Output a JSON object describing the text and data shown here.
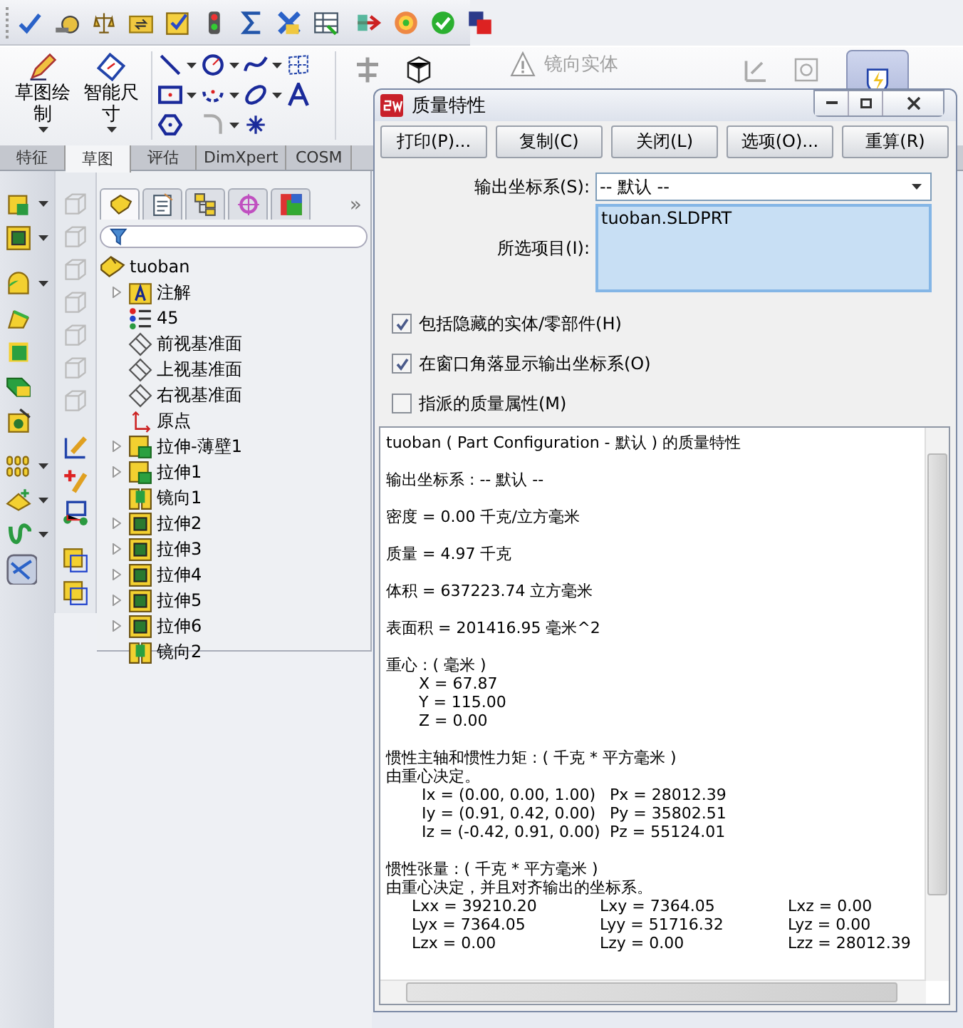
{
  "ribbon": {
    "buttons": [
      {
        "label": "草图绘制"
      },
      {
        "label": "智能尺寸"
      }
    ],
    "mirror_entities": {
      "label": "镜向实体",
      "disabled": true
    }
  },
  "tabs": [
    {
      "label": "特征",
      "selected": false
    },
    {
      "label": "草图",
      "selected": true
    },
    {
      "label": "评估",
      "selected": false
    },
    {
      "label": "DimXpert",
      "selected": false
    },
    {
      "label": "COSM",
      "selected": false
    }
  ],
  "panel_tabs": [
    {
      "selected": true
    },
    {
      "selected": false
    },
    {
      "selected": false
    },
    {
      "selected": false
    },
    {
      "selected": false
    }
  ],
  "panel_more": "»",
  "tree": {
    "label": "tuoban",
    "children": [
      {
        "label": "注解",
        "kind": "annotations",
        "expandable": true
      },
      {
        "label": "45",
        "kind": "sensors",
        "expandable": false
      },
      {
        "label": "前视基准面",
        "kind": "plane",
        "expandable": false
      },
      {
        "label": "上视基准面",
        "kind": "plane",
        "expandable": false
      },
      {
        "label": "右视基准面",
        "kind": "plane",
        "expandable": false
      },
      {
        "label": "原点",
        "kind": "origin",
        "expandable": false
      },
      {
        "label": "拉伸-薄壁1",
        "kind": "thin_extrude",
        "expandable": true
      },
      {
        "label": "拉伸1",
        "kind": "thin_extrude",
        "expandable": true
      },
      {
        "label": "镜向1",
        "kind": "mirror",
        "expandable": false
      },
      {
        "label": "拉伸2",
        "kind": "extrude",
        "expandable": true
      },
      {
        "label": "拉伸3",
        "kind": "extrude",
        "expandable": true
      },
      {
        "label": "拉伸4",
        "kind": "extrude",
        "expandable": true
      },
      {
        "label": "拉伸5",
        "kind": "extrude",
        "expandable": true
      },
      {
        "label": "拉伸6",
        "kind": "extrude",
        "expandable": true
      },
      {
        "label": "镜向2",
        "kind": "mirror",
        "expandable": false
      }
    ]
  },
  "dialog": {
    "title": "质量特性",
    "buttons": [
      "打印(P)...",
      "复制(C)",
      "关闭(L)",
      "选项(O)...",
      "重算(R)"
    ],
    "coordinate_system": {
      "label": "输出坐标系(S):",
      "value": "-- 默认 --"
    },
    "selected_items": {
      "label": "所选项目(I):",
      "items": [
        "tuoban.SLDPRT"
      ]
    },
    "options": [
      {
        "label": "包括隐藏的实体/零部件(H)",
        "checked": true
      },
      {
        "label": "在窗口角落显示输出坐标系(O)",
        "checked": true
      },
      {
        "label": "指派的质量属性(M)",
        "checked": false
      }
    ],
    "report": [
      {
        "kind": "line",
        "text": "tuoban ( Part Configuration - 默认 ) 的质量特性"
      },
      {
        "kind": "line",
        "text": "输出坐标系 : -- 默认 --"
      },
      {
        "kind": "line",
        "text": "密度 = 0.00 千克/立方毫米"
      },
      {
        "kind": "line",
        "text": "质量 = 4.97 千克"
      },
      {
        "kind": "line",
        "text": "体积 = 637223.74 立方毫米"
      },
      {
        "kind": "line",
        "text": "表面积 = 201416.95 毫米^2"
      },
      {
        "kind": "table",
        "title": "重心 : ( 毫米 )",
        "rows": [
          [
            "X = 67.87"
          ],
          [
            "Y = 115.00"
          ],
          [
            "Z = 0.00"
          ]
        ]
      },
      {
        "kind": "table",
        "title": "惯性主轴和惯性力矩 : ( 千克 * 平方毫米 )",
        "note": "由重心决定。",
        "rows": [
          [
            "Ix = (0.00, 0.00, 1.00)",
            "Px = 28012.39"
          ],
          [
            "Iy = (0.91, 0.42, 0.00)",
            "Py = 35802.51"
          ],
          [
            "Iz = (-0.42, 0.91, 0.00)",
            "Pz = 55124.01"
          ]
        ]
      },
      {
        "kind": "table",
        "title": "惯性张量 : ( 千克 * 平方毫米 )",
        "note": "由重心决定，并且对齐输出的坐标系。",
        "rows": [
          [
            "Lxx = 39210.20",
            "Lxy = 7364.05",
            "Lxz = 0.00"
          ],
          [
            "Lyx = 7364.05",
            "Lyy = 51716.32",
            "Lyz = 0.00"
          ],
          [
            "Lzx = 0.00",
            "Lzy = 0.00",
            "Lzz = 28012.39"
          ]
        ]
      }
    ]
  }
}
